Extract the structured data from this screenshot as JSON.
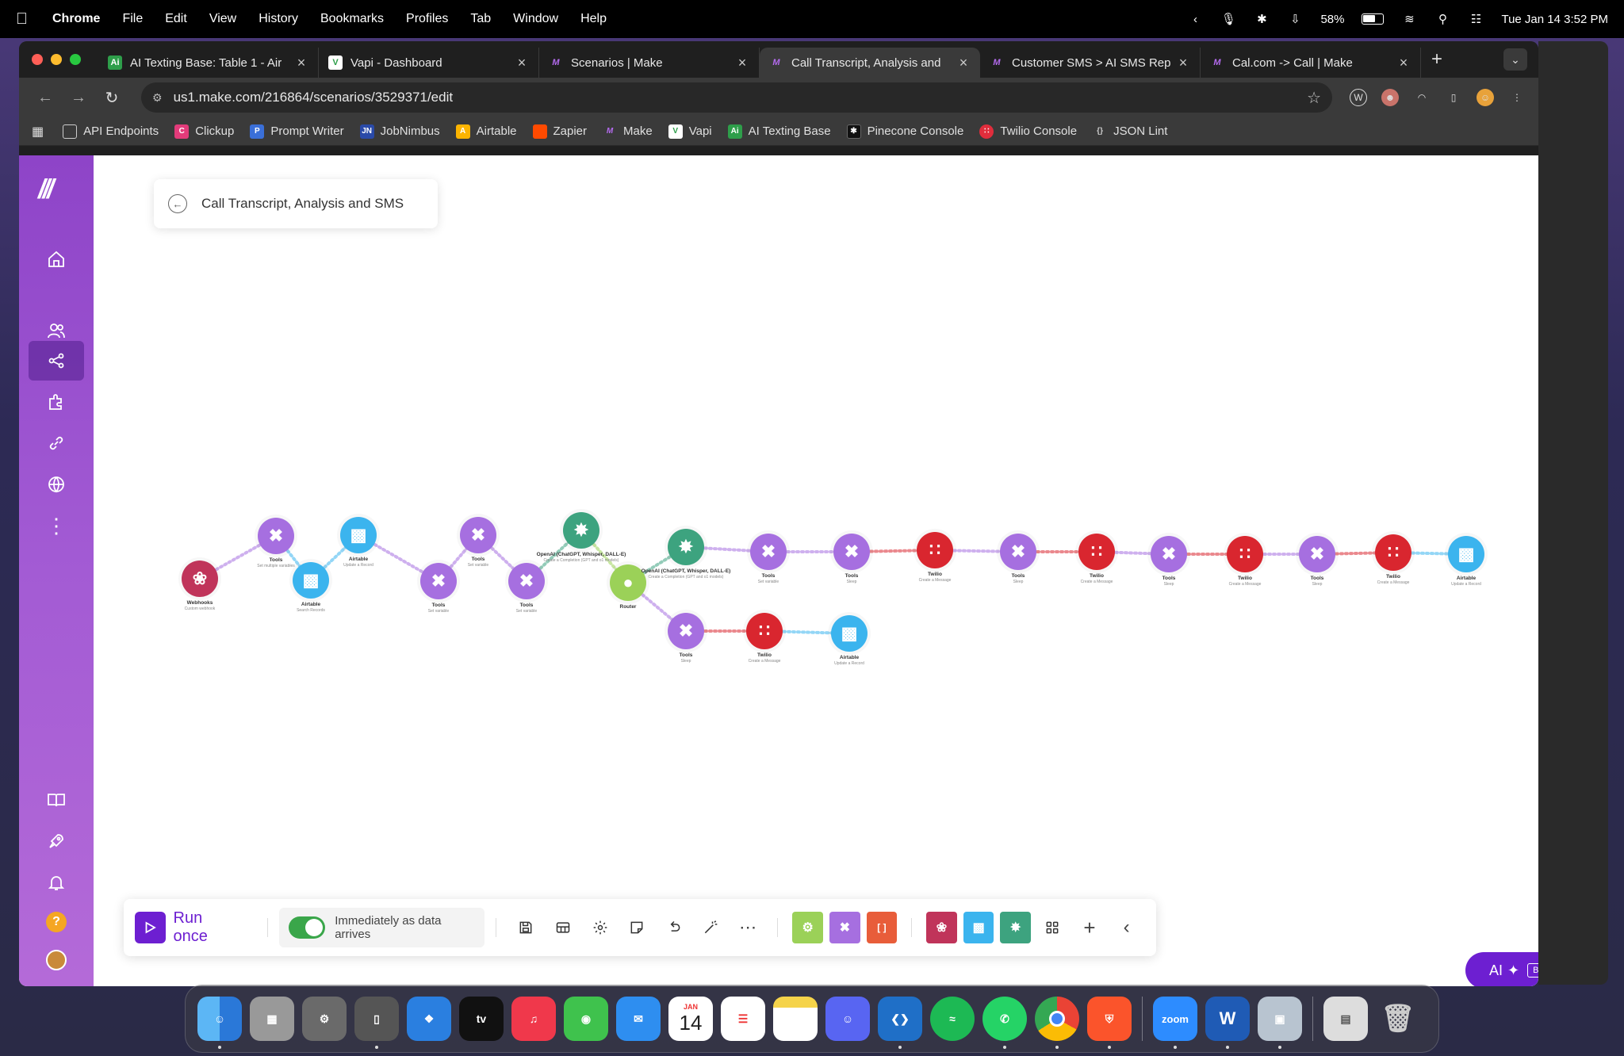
{
  "menubar": {
    "app": "Chrome",
    "items": [
      "File",
      "Edit",
      "View",
      "History",
      "Bookmarks",
      "Profiles",
      "Tab",
      "Window",
      "Help"
    ],
    "battery": "58%",
    "datetime": "Tue Jan 14  3:52 PM"
  },
  "tabs": [
    {
      "label": "AI Texting Base: Table 1 - Air",
      "favicon": "Ai",
      "color": "#2e9e4a"
    },
    {
      "label": "Vapi - Dashboard",
      "favicon": "V",
      "color": "#1f1f1f"
    },
    {
      "label": "Scenarios | Make",
      "favicon": "M",
      "color": "#7b2fbf"
    },
    {
      "label": "Call Transcript, Analysis and",
      "favicon": "M",
      "color": "#7b2fbf"
    },
    {
      "label": "Customer SMS > AI SMS Rep",
      "favicon": "M",
      "color": "#7b2fbf"
    },
    {
      "label": "Cal.com -> Call | Make",
      "favicon": "M",
      "color": "#7b2fbf"
    }
  ],
  "address": {
    "url": "us1.make.com/216864/scenarios/3529371/edit"
  },
  "bookmarks": [
    {
      "label": "API Endpoints",
      "icon": "folder-icon",
      "color": "#555"
    },
    {
      "label": "Clickup",
      "icon": "clickup-icon",
      "color": "#e23b7a"
    },
    {
      "label": "Prompt Writer",
      "icon": "prompt-writer-icon",
      "color": "#3a6fd8"
    },
    {
      "label": "JobNimbus",
      "icon": "jobnimbus-icon",
      "color": "#2a4aa8"
    },
    {
      "label": "Airtable",
      "icon": "airtable-icon",
      "color": "#fcb400"
    },
    {
      "label": "Zapier",
      "icon": "zapier-icon",
      "color": "#ff4a00"
    },
    {
      "label": "Make",
      "icon": "make-icon",
      "color": "#7b2fbf"
    },
    {
      "label": "Vapi",
      "icon": "vapi-icon",
      "color": "#1f1f1f"
    },
    {
      "label": "AI Texting Base",
      "icon": "ai-texting-icon",
      "color": "#2e9e4a"
    },
    {
      "label": "Pinecone Console",
      "icon": "pinecone-icon",
      "color": "#111"
    },
    {
      "label": "Twilio Console",
      "icon": "twilio-icon",
      "color": "#e02d3c"
    },
    {
      "label": "JSON Lint",
      "icon": "jsonlint-icon",
      "color": "#444"
    }
  ],
  "scenario": {
    "title": "Call Transcript, Analysis and SMS"
  },
  "colors": {
    "tools": "#a66fe0",
    "airtable": "#3bb4ee",
    "openai": "#3da37f",
    "twilio": "#d9262f",
    "webhooks": "#c0345a",
    "router": "#9bd158"
  },
  "nodes": [
    {
      "app": "Webhooks",
      "action": "Custom webhook",
      "kind": "webhooks"
    },
    {
      "app": "Tools",
      "action": "Set multiple variables",
      "kind": "tools"
    },
    {
      "app": "Airtable",
      "action": "Search Records",
      "kind": "airtable"
    },
    {
      "app": "Airtable",
      "action": "Update a Record",
      "kind": "airtable"
    },
    {
      "app": "Tools",
      "action": "Set variable",
      "kind": "tools"
    },
    {
      "app": "Tools",
      "action": "Set variable",
      "kind": "tools"
    },
    {
      "app": "Tools",
      "action": "Set variable",
      "kind": "tools"
    },
    {
      "app": "OpenAI (ChatGPT, Whisper, DALL-E)",
      "action": "Create a Completion (GPT and o1 models)",
      "kind": "openai"
    },
    {
      "app": "Router",
      "action": "",
      "kind": "router"
    },
    {
      "app": "OpenAI (ChatGPT, Whisper, DALL-E)",
      "action": "Create a Completion (GPT and o1 models)",
      "kind": "openai"
    },
    {
      "app": "Tools",
      "action": "Set variable",
      "kind": "tools"
    },
    {
      "app": "Tools",
      "action": "Sleep",
      "kind": "tools"
    },
    {
      "app": "Twilio",
      "action": "Create a Message",
      "kind": "twilio"
    },
    {
      "app": "Tools",
      "action": "Sleep",
      "kind": "tools"
    },
    {
      "app": "Twilio",
      "action": "Create a Message",
      "kind": "twilio"
    },
    {
      "app": "Tools",
      "action": "Sleep",
      "kind": "tools"
    },
    {
      "app": "Twilio",
      "action": "Create a Message",
      "kind": "twilio"
    },
    {
      "app": "Tools",
      "action": "Sleep",
      "kind": "tools"
    },
    {
      "app": "Twilio",
      "action": "Create a Message",
      "kind": "twilio"
    },
    {
      "app": "Airtable",
      "action": "Update a Record",
      "kind": "airtable"
    },
    {
      "app": "Tools",
      "action": "Sleep",
      "kind": "tools"
    },
    {
      "app": "Twilio",
      "action": "Create a Message",
      "kind": "twilio"
    },
    {
      "app": "Airtable",
      "action": "Update a Record",
      "kind": "airtable"
    }
  ],
  "bottombar": {
    "run_label": "Run once",
    "schedule_label": "Immediately as data arrives"
  },
  "ai_button": {
    "label": "AI",
    "badge": "BETA"
  },
  "dock": [
    {
      "name": "Finder",
      "color": "#3a8ee6"
    },
    {
      "name": "Launchpad",
      "color": "#888"
    },
    {
      "name": "System Settings",
      "color": "#6a6a6a"
    },
    {
      "name": "iPhone Mirroring",
      "color": "#555"
    },
    {
      "name": "Safari",
      "color": "#2a7fe0"
    },
    {
      "name": "TV",
      "color": "#111"
    },
    {
      "name": "Music",
      "color": "#f0384b"
    },
    {
      "name": "Messages",
      "color": "#3fc24d"
    },
    {
      "name": "Mail",
      "color": "#2e8ef0"
    },
    {
      "name": "Calendar",
      "color": "#ffffff"
    },
    {
      "name": "Reminders",
      "color": "#ffffff"
    },
    {
      "name": "Notes",
      "color": "#f5d34a"
    },
    {
      "name": "Discord",
      "color": "#5865f2"
    },
    {
      "name": "VS Code",
      "color": "#1f6fc7"
    },
    {
      "name": "Spotify",
      "color": "#1db954"
    },
    {
      "name": "WhatsApp",
      "color": "#25d366"
    },
    {
      "name": "Chrome",
      "color": "#e8e8e8"
    },
    {
      "name": "Brave",
      "color": "#fb542b"
    },
    {
      "name": "Zoom",
      "color": "#2d8cff"
    },
    {
      "name": "Word",
      "color": "#1f5bb5"
    },
    {
      "name": "Preview",
      "color": "#b8c4d0"
    },
    {
      "name": "Documents",
      "color": "#ddd"
    },
    {
      "name": "Trash",
      "color": "#9a9a9a"
    }
  ],
  "dock_text": {
    "calendar_month": "JAN",
    "calendar_day": "14",
    "tv_label": "tv",
    "zoom_label": "zoom",
    "word_label": "W"
  }
}
